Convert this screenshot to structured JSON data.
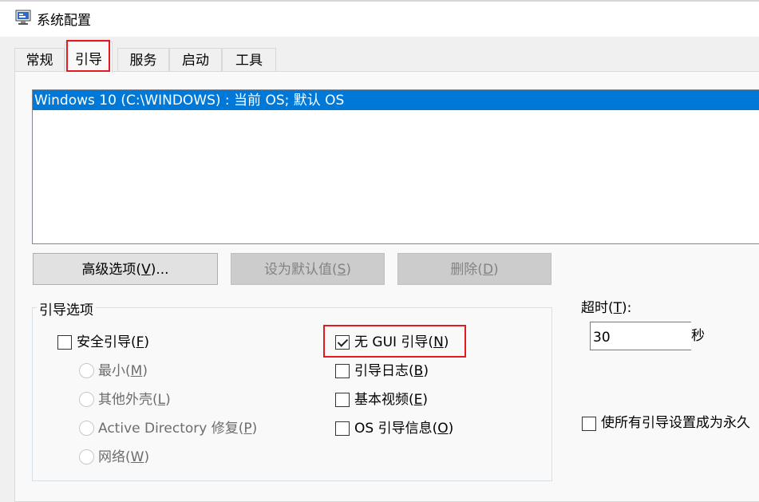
{
  "window": {
    "title": "系统配置"
  },
  "tabs": [
    {
      "label": "常规"
    },
    {
      "label": "引导"
    },
    {
      "label": "服务"
    },
    {
      "label": "启动"
    },
    {
      "label": "工具"
    }
  ],
  "os_list": {
    "items": [
      "Windows 10 (C:\\WINDOWS) : 当前 OS; 默认 OS"
    ]
  },
  "buttons": {
    "advanced": {
      "label_pre": "高级选项(",
      "accel": "V",
      "label_post": ")..."
    },
    "set_default": {
      "label_pre": "设为默认值(",
      "accel": "S",
      "label_post": ")"
    },
    "delete": {
      "label_pre": "删除(",
      "accel": "D",
      "label_post": ")"
    }
  },
  "boot_options": {
    "group_label": "引导选项",
    "safe_boot": {
      "label_pre": "安全引导(",
      "accel": "F",
      "label_post": ")",
      "checked": false
    },
    "safe_modes": [
      {
        "label_pre": "最小(",
        "accel": "M",
        "label_post": ")"
      },
      {
        "label_pre": "其他外壳(",
        "accel": "L",
        "label_post": ")"
      },
      {
        "label_pre": "Active Directory 修复(",
        "accel": "P",
        "label_post": ")"
      },
      {
        "label_pre": "网络(",
        "accel": "W",
        "label_post": ")"
      }
    ],
    "no_gui": {
      "label_pre": "无 GUI 引导(",
      "accel": "N",
      "label_post": ")",
      "checked": true
    },
    "boot_log": {
      "label_pre": "引导日志(",
      "accel": "B",
      "label_post": ")",
      "checked": false
    },
    "base_video": {
      "label_pre": "基本视频(",
      "accel": "E",
      "label_post": ")",
      "checked": false
    },
    "os_info": {
      "label_pre": "OS 引导信息(",
      "accel": "O",
      "label_post": ")",
      "checked": false
    }
  },
  "timeout": {
    "label_pre": "超时(",
    "accel": "T",
    "label_post": "):",
    "value": "30",
    "unit": "秒"
  },
  "make_permanent": {
    "label": "使所有引导设置成为永久",
    "checked": false
  },
  "colors": {
    "selection": "#0078d7",
    "highlight_box": "#e5191e"
  }
}
